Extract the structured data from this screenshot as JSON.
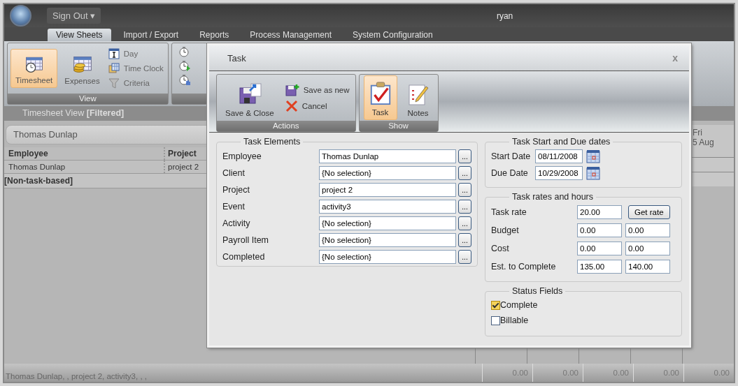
{
  "app": {
    "user_menu": "Sign Out ▾",
    "user": "ryan",
    "tabs": [
      {
        "label": "View Sheets",
        "selected": true
      },
      {
        "label": "Import / Export",
        "selected": false
      },
      {
        "label": "Reports",
        "selected": false
      },
      {
        "label": "Process Management",
        "selected": false
      },
      {
        "label": "System Configuration",
        "selected": false
      }
    ],
    "ribbon": {
      "label": "View",
      "large_items": [
        {
          "label": "Timesheet",
          "selected": true
        },
        {
          "label": "Expenses",
          "selected": false
        }
      ],
      "small_items": [
        "Day",
        "Time Clock",
        "Criteria"
      ]
    },
    "view_header": "Timesheet View **[Filtered]**",
    "filter_value": "Thomas Dunlap",
    "grid": {
      "columns": [
        "Employee",
        "Project"
      ],
      "rows": [
        [
          "Thomas Dunlap",
          "project 2"
        ]
      ],
      "group_row": "[Non-task-based]"
    },
    "day_columns": [
      {
        "total": "0.00"
      },
      {
        "total": "0.00"
      },
      {
        "total": "0.00"
      },
      {
        "total": "0.00"
      },
      {
        "day": "Fri",
        "date": "5 Aug",
        "total": "0.00"
      }
    ],
    "status_bar": "Thomas Dunlap, , project 2, activity3, , ,"
  },
  "dialog": {
    "title": "Task",
    "close": "x",
    "ribbon": [
      {
        "label": "Actions",
        "items": [
          {
            "label": "Save & Close",
            "kind": "large",
            "selected": false
          },
          {
            "label": "Save as new",
            "kind": "small"
          },
          {
            "label": "Cancel",
            "kind": "small"
          }
        ]
      },
      {
        "label": "Show",
        "items": [
          {
            "label": "Task",
            "kind": "large",
            "selected": true
          },
          {
            "label": "Notes",
            "kind": "large",
            "selected": false
          }
        ]
      }
    ],
    "task_elements": {
      "title": "Task Elements",
      "rows": [
        {
          "label": "Employee",
          "value": "Thomas Dunlap",
          "button": "..."
        },
        {
          "label": "Client",
          "value": "{No selection}",
          "button": "..."
        },
        {
          "label": "Project",
          "value": "project 2",
          "button": "..."
        },
        {
          "label": "Event",
          "value": "activity3",
          "button": "..."
        },
        {
          "label": "Activity",
          "value": "{No selection}",
          "button": "..."
        },
        {
          "label": "Payroll Item",
          "value": "{No selection}",
          "button": "..."
        },
        {
          "label": "Completed",
          "value": "{No selection}",
          "button": "..."
        }
      ]
    },
    "dates": {
      "title": "Task Start and Due dates",
      "rows": [
        {
          "label": "Start Date",
          "value": "08/11/2008"
        },
        {
          "label": "Due Date",
          "value": "10/29/2008"
        }
      ]
    },
    "rates": {
      "title": "Task rates and hours",
      "rows": [
        {
          "label": "Task rate",
          "values": [
            "20.00"
          ],
          "button": "Get rate"
        },
        {
          "label": "Budget",
          "values": [
            "0.00",
            "0.00"
          ]
        },
        {
          "label": "Cost",
          "values": [
            "0.00",
            "0.00"
          ]
        },
        {
          "label": "Est. to Complete",
          "values": [
            "135.00",
            "140.00"
          ]
        }
      ]
    },
    "status": {
      "title": "Status Fields",
      "items": [
        {
          "label": "Complete",
          "checked": true
        },
        {
          "label": "Billable",
          "checked": false
        }
      ]
    }
  }
}
